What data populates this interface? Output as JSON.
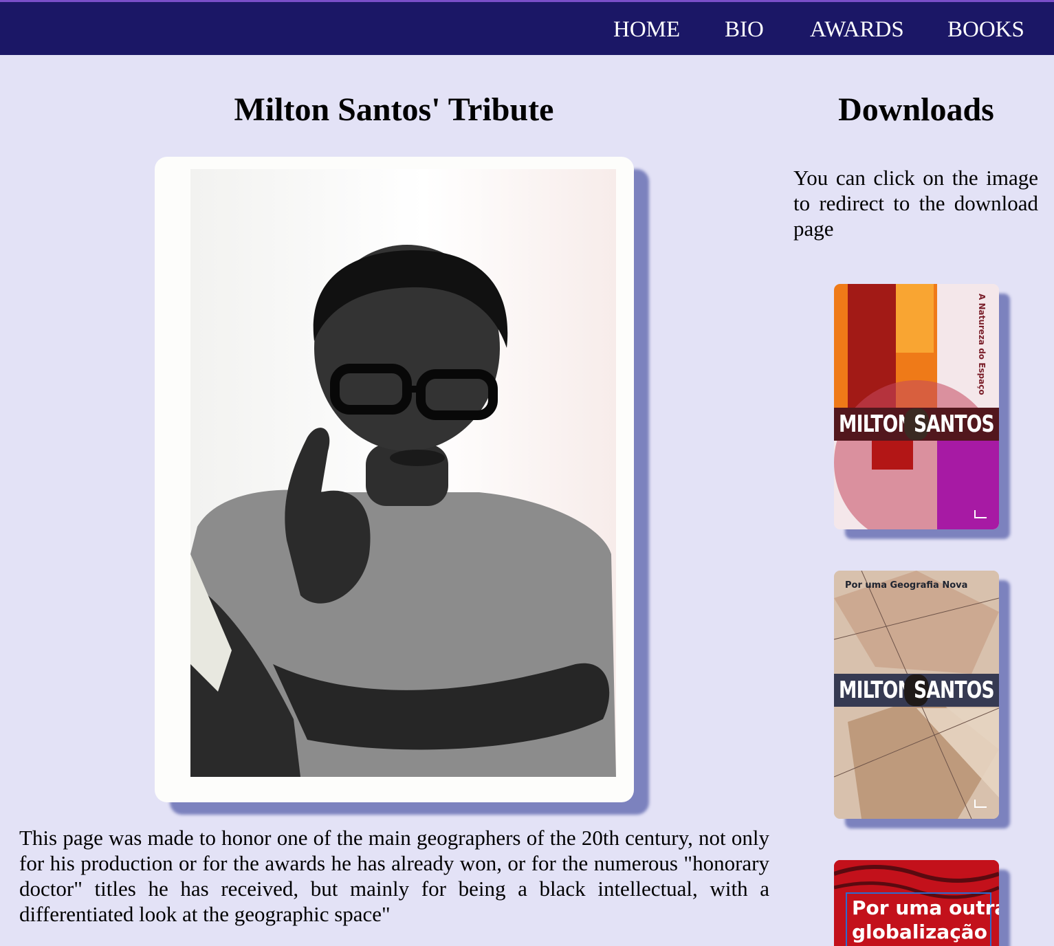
{
  "nav": {
    "items": [
      "HOME",
      "BIO",
      "AWARDS",
      "BOOKS"
    ]
  },
  "main": {
    "title": "Milton Santos' Tribute",
    "description": "This page was made to honor one of the main geographers of the 20th century, not only for his production or for the awards he has already won, or for the numerous \"honorary doctor\" titles he has received, but mainly for being a black intellectual, with a differentiated look at the geographic space\""
  },
  "downloads": {
    "title": "Downloads",
    "instructions": "You can click on the image to redirect to the download page",
    "books": [
      {
        "subtitle": "A Natureza do Espaço",
        "author_first": "MILTON",
        "author_last": "SANTOS"
      },
      {
        "subtitle": "Por uma Geografia Nova",
        "author_first": "MILTON",
        "author_last": "SANTOS"
      },
      {
        "subtitle_line1": "Por uma outra",
        "subtitle_line2": "globalização"
      }
    ]
  },
  "colors": {
    "navbar": "#1b1766",
    "background": "#e3e2f6",
    "shadow": "#767cba",
    "accent_line": "#7a4fc9"
  }
}
